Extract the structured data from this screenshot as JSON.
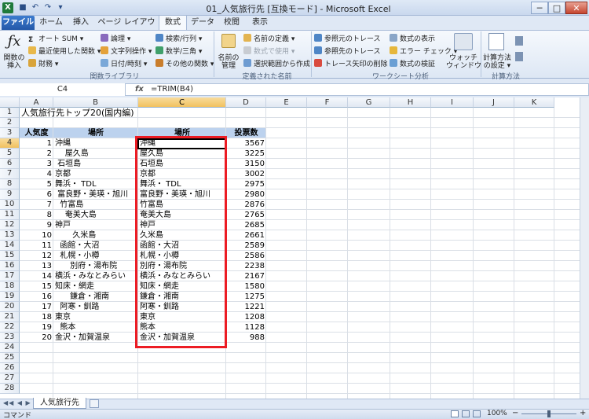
{
  "window": {
    "title": "01_人気旅行先 [互換モード] - Microsoft Excel",
    "app_icon": "X",
    "minimize": "─",
    "maximize": "□",
    "close": "✕"
  },
  "qat": {
    "save": "■",
    "undo": "↶",
    "redo": "↷",
    "more": "▾"
  },
  "tabs": [
    "ファイル",
    "ホーム",
    "挿入",
    "ページ レイアウト",
    "数式",
    "データ",
    "校閲",
    "表示"
  ],
  "active_tab": "数式",
  "ribbon": {
    "insert_function": {
      "line1": "関数の",
      "line2": "挿入"
    },
    "autosum": "オート SUM ▾",
    "recent": "最近使用した関数 ▾",
    "financial": "財務 ▾",
    "logical": "論理 ▾",
    "text": "文字列操作 ▾",
    "datetime": "日付/時刻 ▾",
    "lookup": "検索/行列 ▾",
    "math": "数学/三角 ▾",
    "more_functions": "その他の関数 ▾",
    "function_library_label": "関数ライブラリ",
    "name_manager": {
      "line1": "名前の",
      "line2": "管理"
    },
    "define_name": "名前の定義 ▾",
    "use_in_formula": "数式で使用 ▾",
    "create_from_selection": "選択範囲から作成",
    "defined_names_label": "定義された名前",
    "trace_precedents": "参照元のトレース",
    "trace_dependents": "参照先のトレース",
    "remove_arrows": "トレース矢印の削除 ▾",
    "show_formulas": "数式の表示",
    "error_checking": "エラー チェック ▾",
    "evaluate_formula": "数式の検証",
    "formula_auditing_label": "ワークシート分析",
    "watch_window": {
      "line1": "ウォッチ",
      "line2": "ウィンドウ"
    },
    "calc_options": {
      "line1": "計算方法",
      "line2": "の設定 ▾"
    },
    "calculation_label": "計算方法"
  },
  "formula_bar": {
    "name_box": "C4",
    "fx": "fx",
    "formula": "=TRIM(B4)"
  },
  "columns": [
    "A",
    "B",
    "C",
    "D",
    "E",
    "F",
    "G",
    "H",
    "I",
    "J",
    "K"
  ],
  "selected_column": "C",
  "selected_row": 4,
  "rows": [
    1,
    2,
    3,
    4,
    5,
    6,
    7,
    8,
    9,
    10,
    11,
    12,
    13,
    14,
    15,
    16,
    17,
    18,
    19,
    20,
    21,
    22,
    23,
    24,
    25,
    26,
    27,
    28
  ],
  "sheet": {
    "title": "人気旅行先トップ20(国内編)",
    "headers": {
      "rank": "人気度",
      "place_raw": "場所",
      "place_trim": "場所",
      "votes": "投票数"
    },
    "records": [
      {
        "rank": "1",
        "raw": "沖縄",
        "trim": "沖縄",
        "votes": "3567"
      },
      {
        "rank": "2",
        "raw": "    屋久島",
        "trim": "屋久島",
        "votes": "3225"
      },
      {
        "rank": "3",
        "raw": " 石垣島",
        "trim": "石垣島",
        "votes": "3150"
      },
      {
        "rank": "4",
        "raw": "京都",
        "trim": "京都",
        "votes": "3002"
      },
      {
        "rank": "5",
        "raw": "舞浜・ TDL",
        "trim": "舞浜・ TDL",
        "votes": "2975"
      },
      {
        "rank": "6",
        "raw": " 富良野・美瑛・旭川",
        "trim": "富良野・美瑛・旭川",
        "votes": "2980"
      },
      {
        "rank": "7",
        "raw": "  竹富島",
        "trim": "竹富島",
        "votes": "2876"
      },
      {
        "rank": "8",
        "raw": "    奄美大島",
        "trim": "奄美大島",
        "votes": "2765"
      },
      {
        "rank": "9",
        "raw": "神戸",
        "trim": "神戸",
        "votes": "2685"
      },
      {
        "rank": "10",
        "raw": "       久米島",
        "trim": "久米島",
        "votes": "2661"
      },
      {
        "rank": "11",
        "raw": "  函館・大沼",
        "trim": "函館・大沼",
        "votes": "2589"
      },
      {
        "rank": "12",
        "raw": "  札幌・小樽",
        "trim": "札幌・小樽",
        "votes": "2586"
      },
      {
        "rank": "13",
        "raw": "      別府・湯布院",
        "trim": "別府・湯布院",
        "votes": "2238"
      },
      {
        "rank": "14",
        "raw": "横浜・みなとみらい",
        "trim": "横浜・みなとみらい",
        "votes": "2167"
      },
      {
        "rank": "15",
        "raw": "知床・網走",
        "trim": "知床・網走",
        "votes": "1580"
      },
      {
        "rank": "16",
        "raw": "      鎌倉・湘南",
        "trim": "鎌倉・湘南",
        "votes": "1275"
      },
      {
        "rank": "17",
        "raw": "  阿寒・釧路",
        "trim": "阿寒・釧路",
        "votes": "1221"
      },
      {
        "rank": "18",
        "raw": "東京",
        "trim": "東京",
        "votes": "1208"
      },
      {
        "rank": "19",
        "raw": "  熊本",
        "trim": "熊本",
        "votes": "1128"
      },
      {
        "rank": "20",
        "raw": "金沢・加賀温泉",
        "trim": "金沢・加賀温泉",
        "votes": "988"
      }
    ]
  },
  "sheet_tab": "人気旅行先",
  "status": {
    "mode": "コマンド",
    "zoom": "100%",
    "minus": "−",
    "plus": "+"
  },
  "colors": {
    "highlight": "#ec1c24",
    "header_fill": "#bcd2ee",
    "accent": "#2458a8"
  }
}
